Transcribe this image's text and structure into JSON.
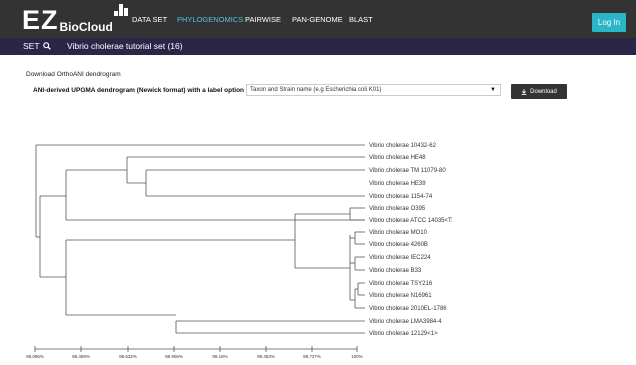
{
  "header": {
    "logo_main": "EZ",
    "logo_sub": "BioCloud",
    "nav": [
      {
        "label": "DATA SET",
        "active": false
      },
      {
        "label": "PHYLOGENOMICS",
        "active": true
      },
      {
        "label": "PAIRWISE",
        "active": false
      },
      {
        "label": "PAN-GENOME",
        "active": false
      },
      {
        "label": "BLAST",
        "active": false
      }
    ],
    "login_label": "Log In"
  },
  "setbar": {
    "set_label": "SET",
    "set_name": "Vibrio cholerae tutorial set (16)"
  },
  "main": {
    "section_title": "Download OrthoANI dendrogram",
    "option_label": "ANI-derived UPGMA dendrogram (Newick format) with a label option of",
    "select_value": "Taxon and Strain name (e.g Escherichia coli K01)",
    "download_label": "Download"
  },
  "tree": {
    "leaves": [
      "Vibrio cholerae 10432-62",
      "Vibrio cholerae HE48",
      "Vibrio cholerae TM 11079-80",
      "Vibrio cholerae HE39",
      "Vibrio cholerae 1154-74",
      "Vibrio cholerae O395",
      "Vibrio cholerae ATCC 14035<T:",
      "Vibrio cholerae MO10",
      "Vibrio cholerae 4260B",
      "Vibrio cholerae IEC224",
      "Vibrio cholerae B33",
      "Vibrio cholerae TSY216",
      "Vibrio cholerae N16961",
      "Vibrio cholerae 2010EL-1786",
      "Vibrio cholerae LMA3984-4",
      "Vibrio cholerae 12129<1>"
    ],
    "axis_ticks": [
      "98.085%",
      "98.359%",
      "98.632%",
      "98.906%",
      "99.18%",
      "99.453%",
      "99.727%",
      "100%"
    ]
  },
  "icons": {
    "search": "search-icon",
    "download": "download-icon",
    "dropdown": "caret-down-icon"
  },
  "colors": {
    "topbar": "#333333",
    "setbar": "#2c2547",
    "accent": "#2ab6c7",
    "active_nav": "#5bc0de"
  }
}
